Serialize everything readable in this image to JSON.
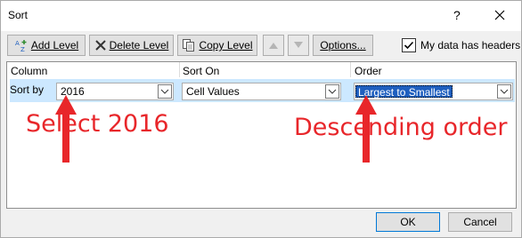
{
  "dialog": {
    "title": "Sort",
    "help": "?"
  },
  "toolbar": {
    "add_level": "Add Level",
    "delete_level": "Delete Level",
    "copy_level": "Copy Level",
    "options": "Options...",
    "headers_label": "My data has headers",
    "headers_checked": true
  },
  "grid": {
    "columns": [
      "Column",
      "Sort On",
      "Order"
    ],
    "row": {
      "label": "Sort by",
      "column_value": "2016",
      "sort_on_value": "Cell Values",
      "order_value": "Largest to Smallest"
    }
  },
  "annotations": {
    "left": "Select 2016",
    "right": "Descending order",
    "color": "#e8262a"
  },
  "footer": {
    "ok": "OK",
    "cancel": "Cancel"
  }
}
